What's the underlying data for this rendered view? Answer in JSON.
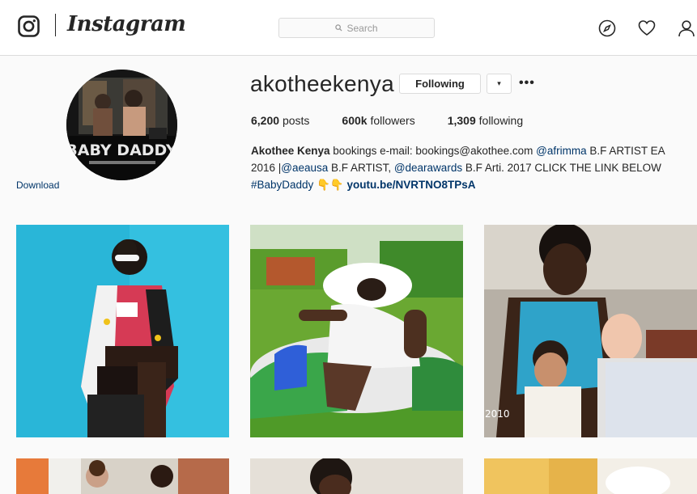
{
  "nav": {
    "brand": "Instagram",
    "search_placeholder": "Search"
  },
  "profile": {
    "avatar_text": "BABY DADDY",
    "download_label": "Download",
    "username": "akotheekenya",
    "following_button": "Following",
    "dropdown_glyph": "▾",
    "more_glyph": "•••",
    "stats": {
      "posts_count": "6,200",
      "posts_label": "posts",
      "followers_count": "600k",
      "followers_label": "followers",
      "following_count": "1,309",
      "following_label": "following"
    },
    "bio": {
      "name": "Akothee Kenya",
      "text1": " bookings e-mail: bookings@akothee.com ",
      "mention1": "@afrimma",
      "text2": " B.F ARTIST EA 2016 |",
      "mention2": "@aeausa",
      "text3": " B.F ARTIST, ",
      "mention3": "@dearawards",
      "text4": " B.F Arti. 2017 CLICK THE LINK BELOW ",
      "hashtag": "#BabyDaddy",
      "emoji": "👇👇",
      "link": "youtu.be/NVRTNO8TPsA"
    }
  },
  "posts": [
    {
      "alt": "woman in patterned jacket on blue background"
    },
    {
      "alt": "woman in white hat on inflatable ring on grass"
    },
    {
      "alt": "family photo with baby",
      "stamp": "2010"
    },
    {
      "alt": "photo row 2 item 1"
    },
    {
      "alt": "photo row 2 item 2"
    },
    {
      "alt": "photo row 2 item 3"
    }
  ],
  "colors": {
    "link": "#003569",
    "border": "#dbdbdb",
    "background": "#fafafa",
    "text": "#262626"
  }
}
